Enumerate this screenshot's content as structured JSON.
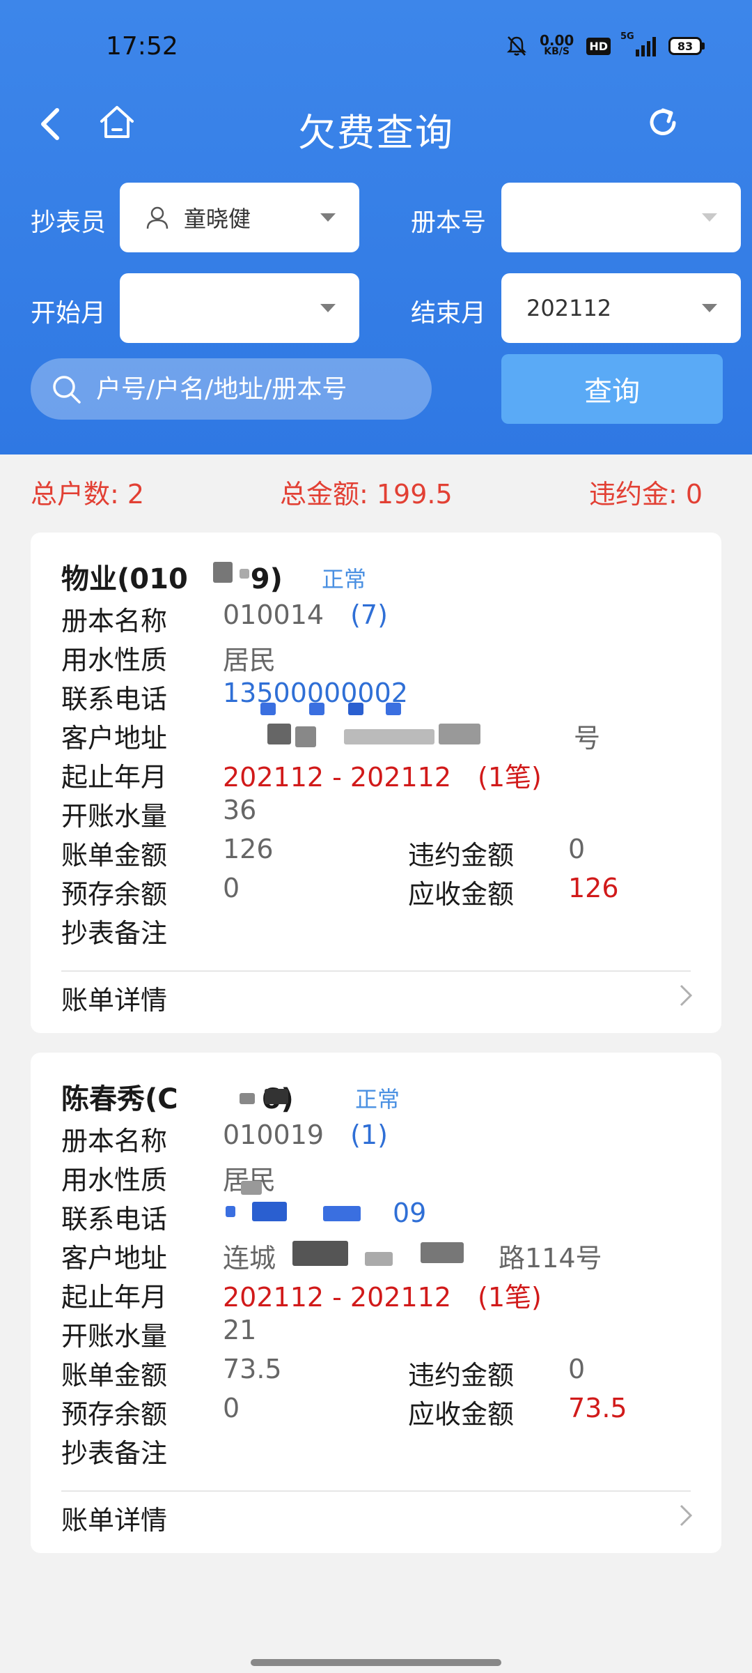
{
  "status_bar": {
    "time": "17:52",
    "net_speed_value": "0.00",
    "net_speed_unit": "KB/S",
    "hd": "HD",
    "network": "5G",
    "battery": "83",
    "icons": [
      "mute-icon",
      "hd-icon",
      "signal-icon",
      "battery-icon"
    ]
  },
  "nav": {
    "title": "欠费查询",
    "icons": [
      "back-icon",
      "home-icon",
      "refresh-icon"
    ]
  },
  "filters": {
    "reader_label": "抄表员",
    "reader_value": "童晓健",
    "book_label": "册本号",
    "book_value": "",
    "start_label": "开始月",
    "start_value": "",
    "end_label": "结束月",
    "end_value": "202112",
    "search_placeholder": "户号/户名/地址/册本号",
    "query_label": "查询"
  },
  "summary": {
    "total_households": "总户数: 2",
    "total_amount": "总金额: 199.5",
    "penalty": "违约金: 0"
  },
  "labels": {
    "book_name": "册本名称",
    "water_type": "用水性质",
    "phone": "联系电话",
    "address": "客户地址",
    "period": "起止年月",
    "volume": "开账水量",
    "bill_amount": "账单金额",
    "penalty_amount": "违约金额",
    "prepaid": "预存余额",
    "receivable": "应收金额",
    "remark": "抄表备注",
    "bill_detail": "账单详情"
  },
  "records": [
    {
      "title": "物业(010",
      "title_tail": "9)",
      "status": "正常",
      "book_name": "010014",
      "book_count": "(7)",
      "water_type": "居民",
      "phone": "13500000002",
      "address": "号",
      "period": "202112 - 202112",
      "period_count": "(1笔)",
      "volume": "36",
      "bill_amount": "126",
      "penalty_amount": "0",
      "prepaid": "0",
      "receivable": "126",
      "remark": ""
    },
    {
      "title": "陈春秀(C",
      "title_tail": "6)",
      "status": "正常",
      "book_name": "010019",
      "book_count": "(1)",
      "water_type": "居民",
      "phone": "09",
      "address_prefix": "连城",
      "address_suffix": "路114号",
      "period": "202112 - 202112",
      "period_count": "(1笔)",
      "volume": "21",
      "bill_amount": "73.5",
      "penalty_amount": "0",
      "prepaid": "0",
      "receivable": "73.5",
      "remark": ""
    }
  ]
}
